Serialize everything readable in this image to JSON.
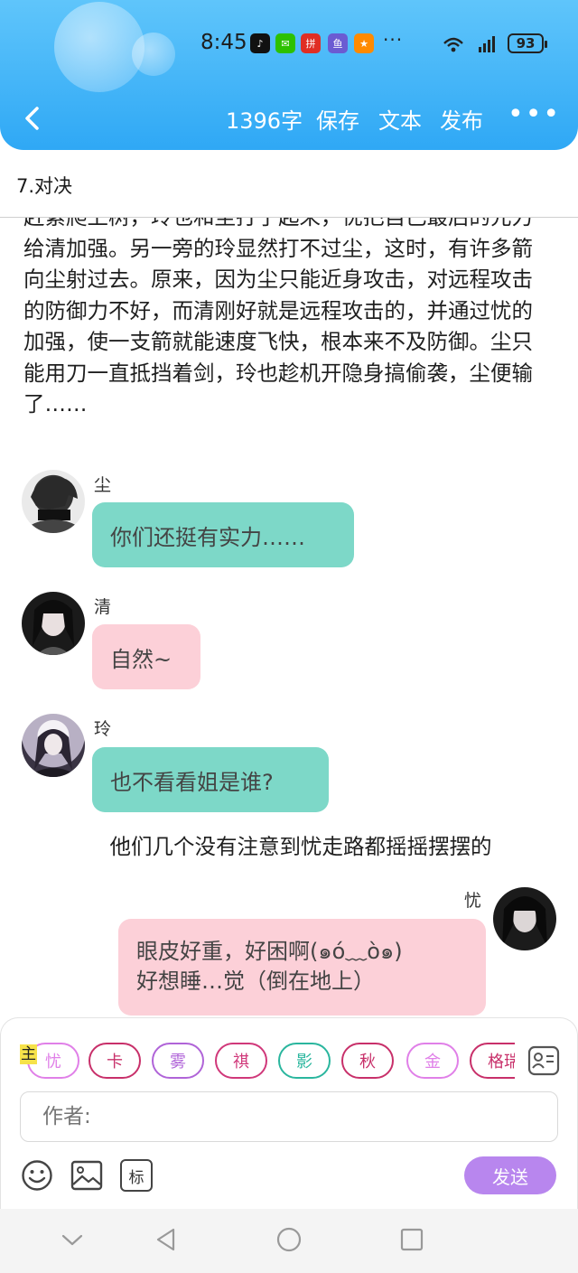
{
  "status_bar": {
    "time": "8:45",
    "apps": [
      {
        "icon": "tiktok-icon",
        "glyph": "♪",
        "color": "#111111"
      },
      {
        "icon": "wechat-icon",
        "glyph": "✉",
        "color": "#2dc100"
      },
      {
        "icon": "pinduoduo-icon",
        "glyph": "拼",
        "color": "#e02e24"
      },
      {
        "icon": "xianyu-icon",
        "glyph": "鱼",
        "color": "#6b5bd2"
      },
      {
        "icon": "game-app-icon",
        "glyph": "★",
        "color": "#ff8a00"
      }
    ],
    "more": "···",
    "signal": "6 5G",
    "battery": "93"
  },
  "nav": {
    "word_count": "1396字",
    "save": "保存",
    "text": "文本",
    "publish": "发布",
    "more": "•••"
  },
  "chapter": {
    "title": "7.对决"
  },
  "narrative": "赶紧爬上树，玲也和尘打了起来，忧把自己最后的元力给清加强。另一旁的玲显然打不过尘，这时，有许多箭向尘射过去。原来，因为尘只能近身攻击，对远程攻击的防御力不好，而清刚好就是远程攻击的，并通过忧的加强，使一支箭就能速度飞快，根本来不及防御。尘只能用刀一直抵挡着剑，玲也趁机开隐身搞偷袭，尘便输了……",
  "messages": [
    {
      "speaker": "尘",
      "text": "你们还挺有实力……",
      "color": "teal"
    },
    {
      "speaker": "清",
      "text": "自然~",
      "color": "pink"
    },
    {
      "speaker": "玲",
      "text": "也不看看姐是谁?",
      "color": "teal"
    }
  ],
  "aside": "他们几个没有注意到忧走路都摇摇摆摆的",
  "right_message": {
    "speaker": "忧",
    "line1": "眼皮好重，好困啊(๑ó﹏ò๑)",
    "line2": "好想睡…觉（倒在地上）"
  },
  "editor": {
    "role_tag": "主",
    "roles": [
      {
        "name": "忧",
        "color": "#e080e8"
      },
      {
        "name": "卡",
        "color": "#c8306a"
      },
      {
        "name": "雾",
        "color": "#b064d8"
      },
      {
        "name": "祺",
        "color": "#d0387a"
      },
      {
        "name": "影",
        "color": "#2ab69e"
      },
      {
        "name": "秋",
        "color": "#c8306a"
      },
      {
        "name": "金",
        "color": "#e080e8"
      },
      {
        "name": "格瑞",
        "color": "#c8306a"
      }
    ],
    "author_placeholder": "作者:",
    "send": "发送",
    "tag_button": "标"
  }
}
